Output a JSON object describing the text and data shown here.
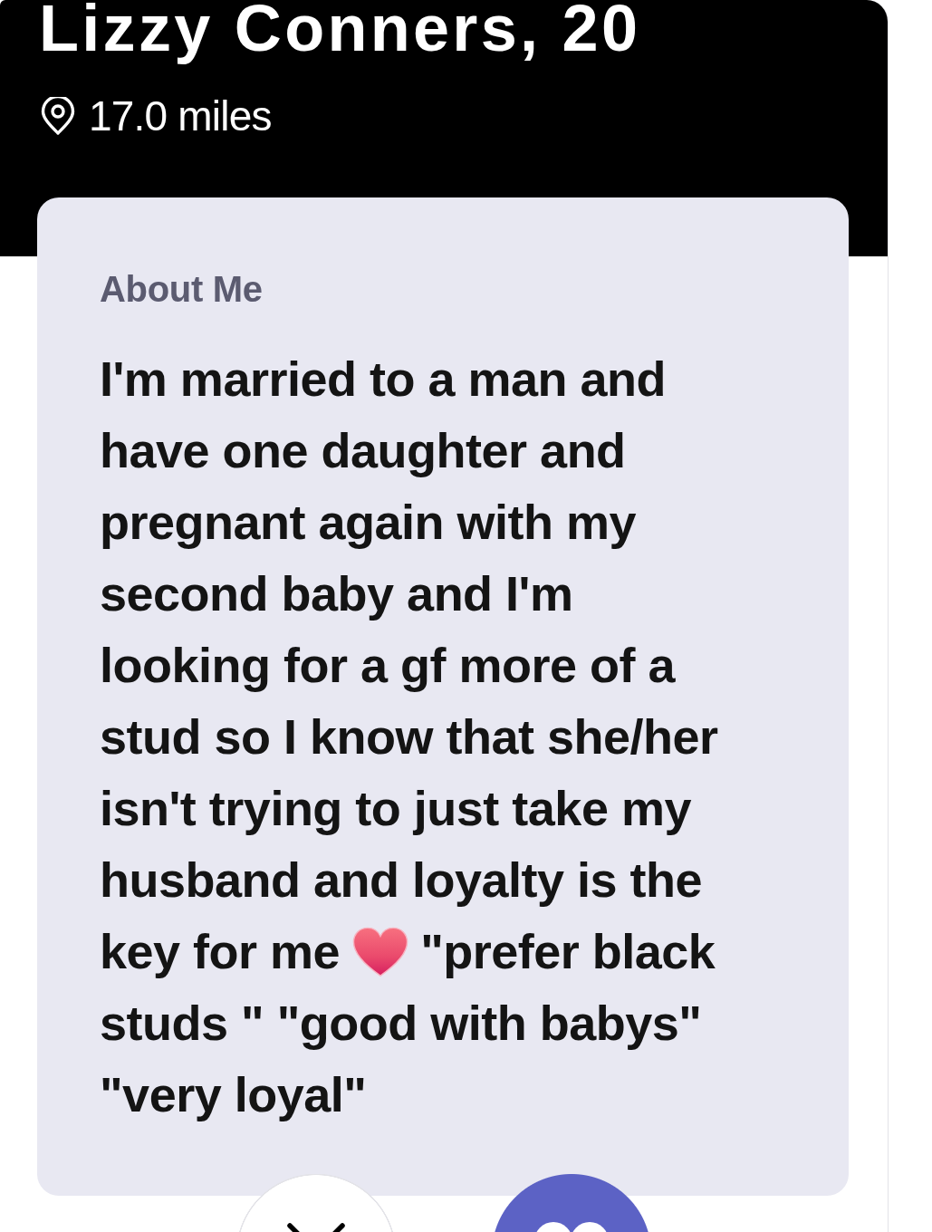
{
  "profile": {
    "name": "Lizzy Conners, 20",
    "distance": "17.0 miles"
  },
  "about": {
    "heading": "About Me",
    "bio": [
      {
        "kind": "text",
        "text": "I'm married to a man and have one daughter and pregnant again with my second baby and I'm looking for a gf more of a stud so I know that she/her isn't trying to just take my husband and loyalty is the key for me"
      },
      {
        "kind": "emoji"
      },
      {
        "kind": "text",
        "text": "\"prefer black studs \" \"good with babys\" \"very loyal\""
      }
    ]
  },
  "actions": [
    {
      "kind": "dismiss"
    },
    {
      "kind": "like"
    }
  ]
}
